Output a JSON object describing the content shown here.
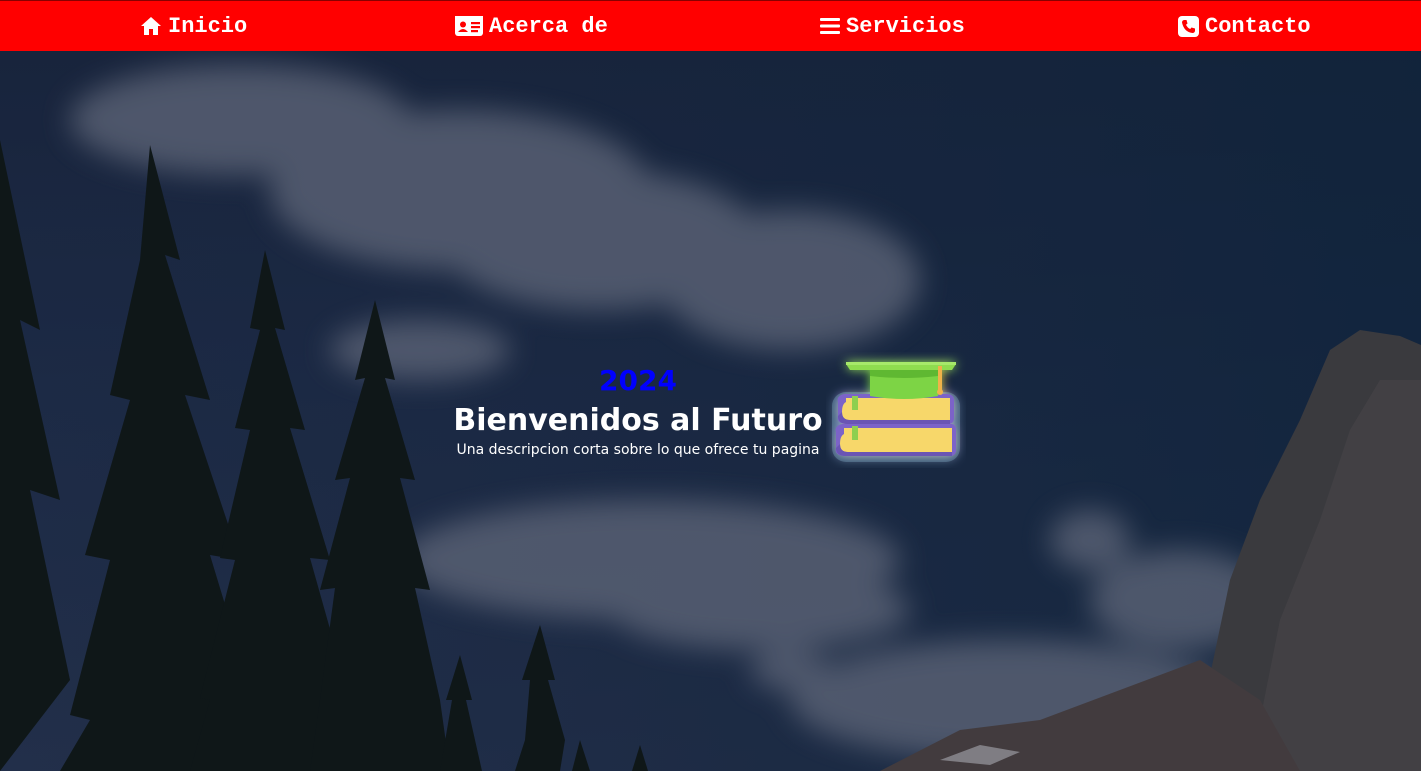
{
  "nav": {
    "items": [
      {
        "label": "Inicio",
        "icon": "home-icon"
      },
      {
        "label": "Acerca de",
        "icon": "id-card-icon"
      },
      {
        "label": "Servicios",
        "icon": "bars-icon"
      },
      {
        "label": "Contacto",
        "icon": "phone-icon"
      }
    ]
  },
  "hero": {
    "year": "2024",
    "title": "Bienvenidos al Futuro",
    "subtitle": "Una descripcion corta sobre lo que ofrece tu pagina",
    "image_icon": "books-graduation-cap-icon"
  },
  "colors": {
    "navbar": "#ff0000",
    "nav_text": "#ffffff",
    "year": "#0000ff",
    "hero_text": "#ffffff"
  }
}
